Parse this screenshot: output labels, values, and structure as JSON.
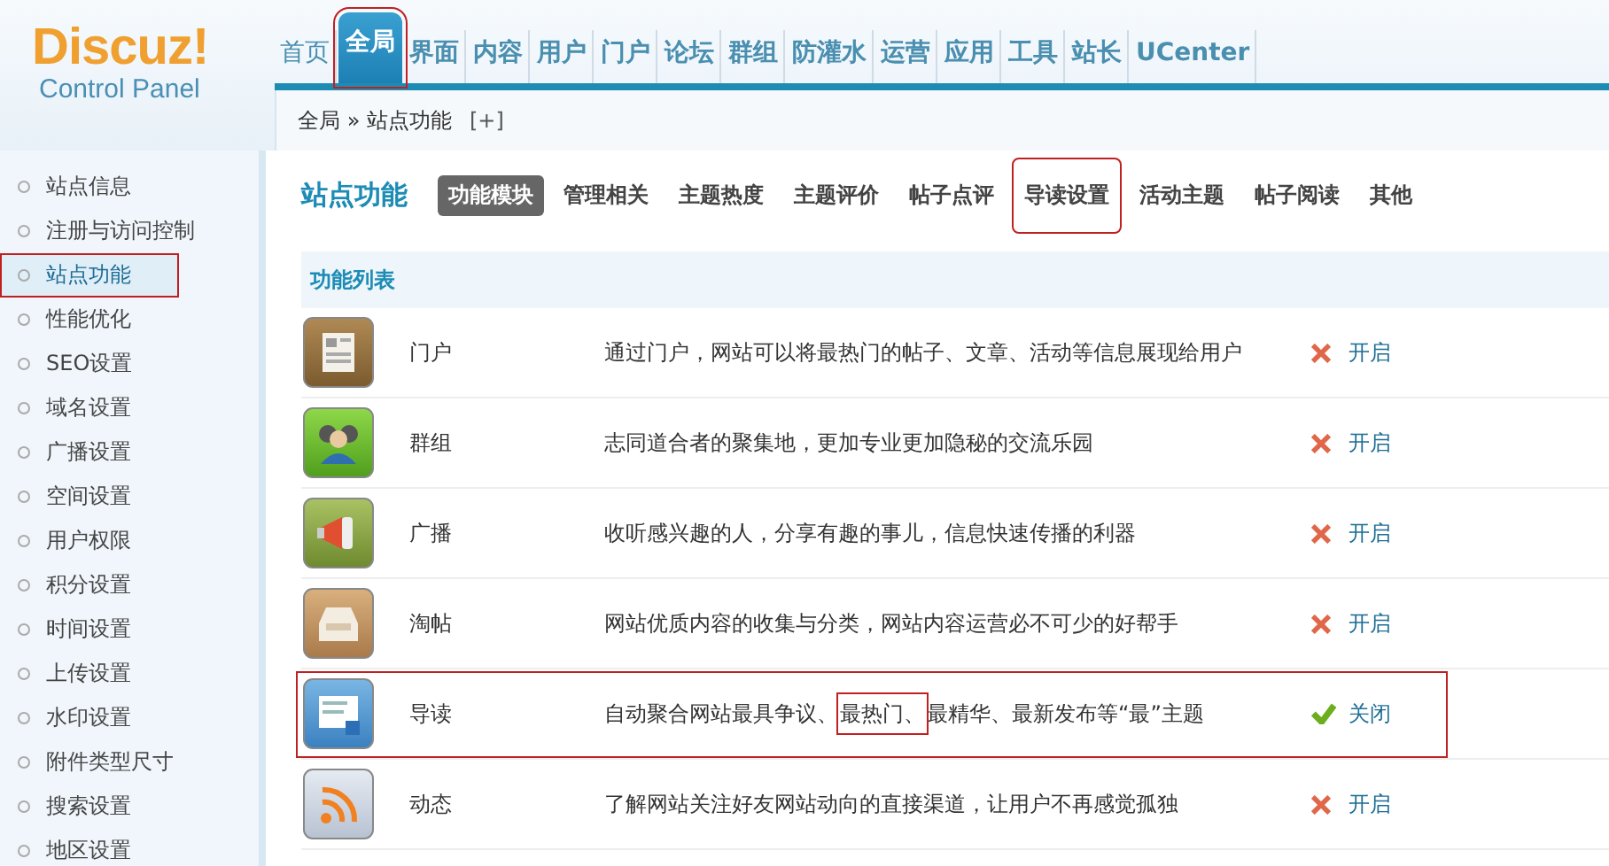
{
  "logo": {
    "title": "Discuz!",
    "subtitle": "Control Panel"
  },
  "nav": [
    {
      "label": "首页",
      "selected": false,
      "highlighted": false
    },
    {
      "label": "全局",
      "selected": true,
      "highlighted": true
    },
    {
      "label": "界面",
      "selected": false,
      "highlighted": false
    },
    {
      "label": "内容",
      "selected": false,
      "highlighted": false
    },
    {
      "label": "用户",
      "selected": false,
      "highlighted": false
    },
    {
      "label": "门户",
      "selected": false,
      "highlighted": false
    },
    {
      "label": "论坛",
      "selected": false,
      "highlighted": false
    },
    {
      "label": "群组",
      "selected": false,
      "highlighted": false
    },
    {
      "label": "防灌水",
      "selected": false,
      "highlighted": false
    },
    {
      "label": "运营",
      "selected": false,
      "highlighted": false
    },
    {
      "label": "应用",
      "selected": false,
      "highlighted": false
    },
    {
      "label": "工具",
      "selected": false,
      "highlighted": false
    },
    {
      "label": "站长",
      "selected": false,
      "highlighted": false
    },
    {
      "label": "UCenter",
      "selected": false,
      "highlighted": false
    }
  ],
  "breadcrumb": {
    "path": "全局 » 站点功能",
    "action": "[+]"
  },
  "sidebar": {
    "items": [
      {
        "label": "站点信息",
        "selected": false,
        "highlighted": false
      },
      {
        "label": "注册与访问控制",
        "selected": false,
        "highlighted": false
      },
      {
        "label": "站点功能",
        "selected": true,
        "highlighted": true
      },
      {
        "label": "性能优化",
        "selected": false,
        "highlighted": false
      },
      {
        "label": "SEO设置",
        "selected": false,
        "highlighted": false
      },
      {
        "label": "域名设置",
        "selected": false,
        "highlighted": false
      },
      {
        "label": "广播设置",
        "selected": false,
        "highlighted": false
      },
      {
        "label": "空间设置",
        "selected": false,
        "highlighted": false
      },
      {
        "label": "用户权限",
        "selected": false,
        "highlighted": false
      },
      {
        "label": "积分设置",
        "selected": false,
        "highlighted": false
      },
      {
        "label": "时间设置",
        "selected": false,
        "highlighted": false
      },
      {
        "label": "上传设置",
        "selected": false,
        "highlighted": false
      },
      {
        "label": "水印设置",
        "selected": false,
        "highlighted": false
      },
      {
        "label": "附件类型尺寸",
        "selected": false,
        "highlighted": false
      },
      {
        "label": "搜索设置",
        "selected": false,
        "highlighted": false
      },
      {
        "label": "地区设置",
        "selected": false,
        "highlighted": false
      }
    ]
  },
  "page_title": "站点功能",
  "tabs": [
    {
      "label": "功能模块",
      "selected": true,
      "highlighted": false
    },
    {
      "label": "管理相关",
      "selected": false,
      "highlighted": false
    },
    {
      "label": "主题热度",
      "selected": false,
      "highlighted": false
    },
    {
      "label": "主题评价",
      "selected": false,
      "highlighted": false
    },
    {
      "label": "帖子点评",
      "selected": false,
      "highlighted": false
    },
    {
      "label": "导读设置",
      "selected": false,
      "highlighted": true
    },
    {
      "label": "活动主题",
      "selected": false,
      "highlighted": false
    },
    {
      "label": "帖子阅读",
      "selected": false,
      "highlighted": false
    },
    {
      "label": "其他",
      "selected": false,
      "highlighted": false
    }
  ],
  "table": {
    "heading": "功能列表",
    "rows": [
      {
        "kind": "portal",
        "name": "门户",
        "description": [
          {
            "text": "通过门户，网站可以将最热门的帖子、文章、活动等信息展现给用户",
            "highlighted": false
          }
        ],
        "enabled": false,
        "action": "开启",
        "highlighted": false
      },
      {
        "kind": "group",
        "name": "群组",
        "description": [
          {
            "text": "志同道合者的聚集地，更加专业更加隐秘的交流乐园",
            "highlighted": false
          }
        ],
        "enabled": false,
        "action": "开启",
        "highlighted": false
      },
      {
        "kind": "broadcast",
        "name": "广播",
        "description": [
          {
            "text": "收听感兴趣的人，分享有趣的事儿，信息快速传播的利器",
            "highlighted": false
          }
        ],
        "enabled": false,
        "action": "开启",
        "highlighted": false
      },
      {
        "kind": "collection",
        "name": "淘帖",
        "description": [
          {
            "text": "网站优质内容的收集与分类，网站内容运营必不可少的好帮手",
            "highlighted": false
          }
        ],
        "enabled": false,
        "action": "开启",
        "highlighted": false
      },
      {
        "kind": "guide",
        "name": "导读",
        "description": [
          {
            "text": "自动聚合网站最具争议、",
            "highlighted": false
          },
          {
            "text": "最热门、",
            "highlighted": true
          },
          {
            "text": "最精华、最新发布等“最”主题",
            "highlighted": false
          }
        ],
        "enabled": true,
        "action": "关闭",
        "highlighted": true
      },
      {
        "kind": "feed",
        "name": "动态",
        "description": [
          {
            "text": "了解网站关注好友网站动向的直接渠道，让用户不再感觉孤独",
            "highlighted": false
          }
        ],
        "enabled": false,
        "action": "开启",
        "highlighted": false
      }
    ]
  }
}
